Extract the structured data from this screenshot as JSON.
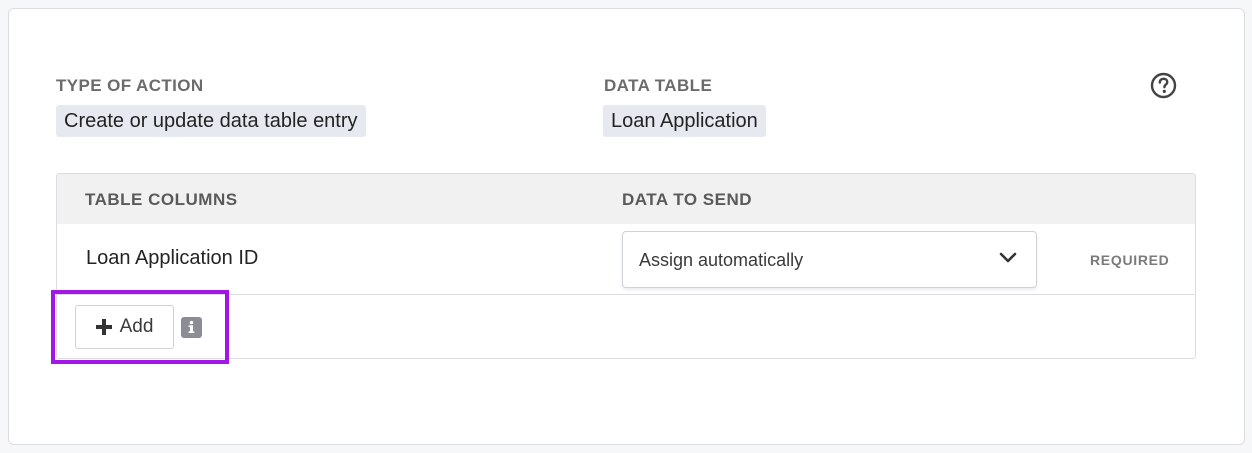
{
  "action": {
    "type_label": "TYPE OF ACTION",
    "type_value": "Create or update data table entry",
    "table_label": "DATA TABLE",
    "table_value": "Loan Application"
  },
  "icons": {
    "help": "help-circle-icon",
    "chevron": "chevron-down-icon",
    "plus": "plus-icon",
    "info": "info-icon"
  },
  "table": {
    "headers": [
      "TABLE COLUMNS",
      "DATA TO SEND"
    ],
    "rows": [
      {
        "column": "Loan Application ID",
        "data_to_send": "Assign automatically",
        "badge": "REQUIRED"
      }
    ]
  },
  "add_button": {
    "label": "Add"
  },
  "colors": {
    "highlight": "#a216e8",
    "chip_bg": "#e6e9f0",
    "header_bg": "#f1f1f2"
  }
}
